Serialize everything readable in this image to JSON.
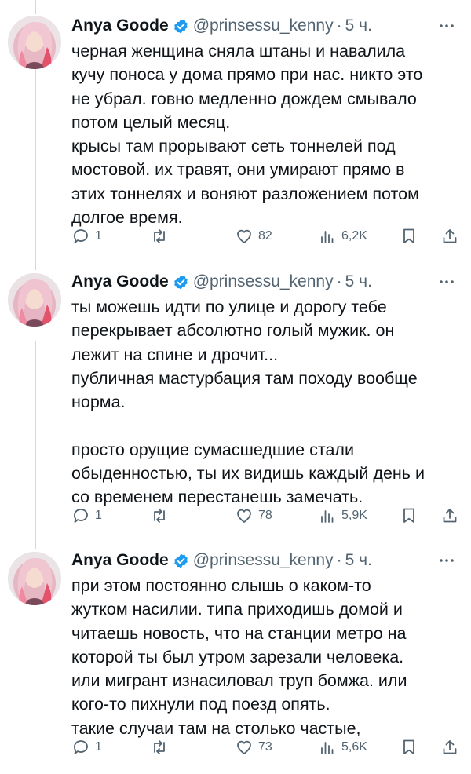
{
  "colors": {
    "verified": "#1d9bf0",
    "text": "#0f1419",
    "secondary": "#536471",
    "thread_line": "#cfd9de"
  },
  "tweets": [
    {
      "author": "Anya Goode",
      "handle": "@prinsessu_kenny",
      "dot": "·",
      "time": "5 ч.",
      "lines": [
        "черная женщина сняла штаны и навалила",
        "кучу поноса у дома прямо при нас. никто это",
        "не убрал. говно медленно дождем смывало",
        "потом целый месяц.",
        "крысы там прорывают сеть тоннелей под",
        "мостовой. их травят, они умирают прямо в",
        "этих тоннелях и воняют разложением потом",
        "долгое время."
      ],
      "replies": "1",
      "retweets": "",
      "likes": "82",
      "views": "6,2K"
    },
    {
      "author": "Anya Goode",
      "handle": "@prinsessu_kenny",
      "dot": "·",
      "time": "5 ч.",
      "lines": [
        "ты можешь идти по улице и дорогу тебе",
        "перекрывает абсолютно голый мужик. он",
        "лежит на спине и дрочит...",
        "публичная мастурбация там походу вообще",
        "норма.",
        "",
        "просто орущие сумасшедшие стали",
        "обыденностью, ты их видишь каждый день и",
        "со временем перестанешь замечать."
      ],
      "replies": "1",
      "retweets": "",
      "likes": "78",
      "views": "5,9K"
    },
    {
      "author": "Anya Goode",
      "handle": "@prinsessu_kenny",
      "dot": "·",
      "time": "5 ч.",
      "lines": [
        "при этом постоянно слышь о каком-то",
        "жутком насилии. типа приходишь домой и",
        "читаешь новость, что на станции метро на",
        "которой ты был утром зарезали человека.",
        "или мигрант изнасиловал труп бомжа. или",
        "кого-то пихнули под поезд опять.",
        "такие случаи там на столько частые,"
      ],
      "replies": "1",
      "retweets": "",
      "likes": "73",
      "views": "5,6K"
    }
  ]
}
